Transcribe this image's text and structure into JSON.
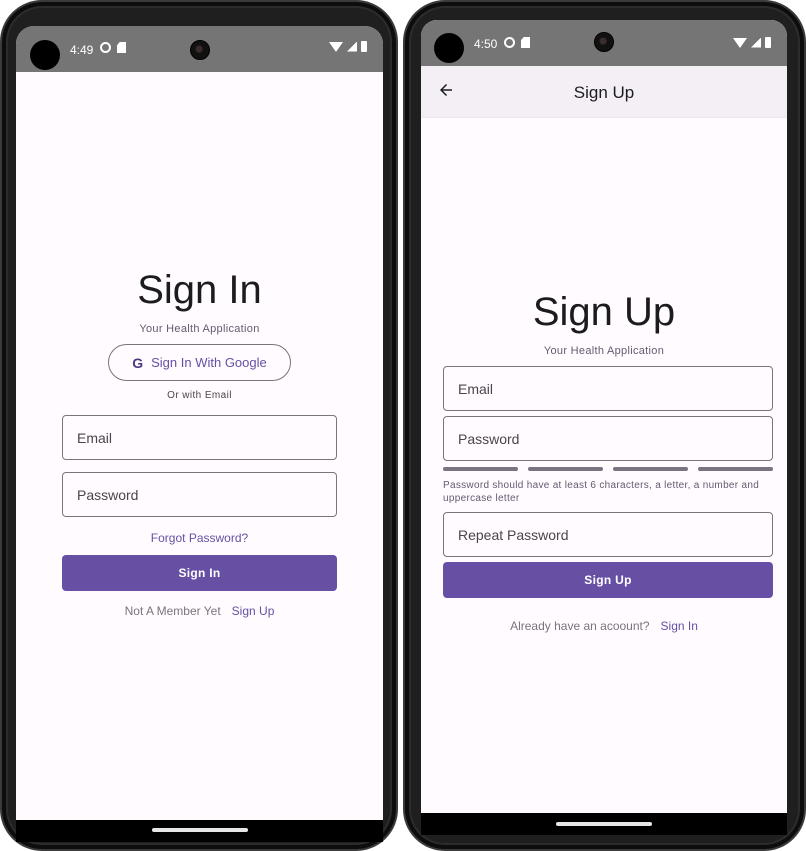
{
  "left_phone": {
    "status": {
      "time": "4:49"
    },
    "title": "Sign In",
    "subtitle": "Your Health Application",
    "google_button": {
      "icon_letter": "G",
      "label": "Sign In With Google"
    },
    "or_text": "Or with Email",
    "email_field": {
      "placeholder": "Email"
    },
    "password_field": {
      "placeholder": "Password"
    },
    "forgot_password": "Forgot Password?",
    "sign_in_button": "Sign In",
    "footer": {
      "prompt": "Not A Member Yet",
      "link": "Sign Up"
    }
  },
  "right_phone": {
    "status": {
      "time": "4:50"
    },
    "app_bar": {
      "title": "Sign Up"
    },
    "title": "Sign Up",
    "subtitle": "Your Health Application",
    "email_field": {
      "placeholder": "Email"
    },
    "password_field": {
      "placeholder": "Password"
    },
    "password_helper": "Password should have at least 6 characters, a letter, a number and uppercase letter",
    "repeat_password_field": {
      "placeholder": "Repeat Password"
    },
    "sign_up_button": "Sign Up",
    "footer": {
      "prompt": "Already have an acoount?",
      "link": "Sign In"
    }
  },
  "colors": {
    "primary": "#6750a4",
    "outline": "#79747e",
    "status_bar": "#757575",
    "app_bar": "#f3eff4",
    "surface": "#fffbfe"
  },
  "icons": [
    "gear-icon",
    "sdcard-icon",
    "wifi-icon",
    "signal-icon",
    "battery-icon",
    "google-icon",
    "back-arrow-icon"
  ]
}
